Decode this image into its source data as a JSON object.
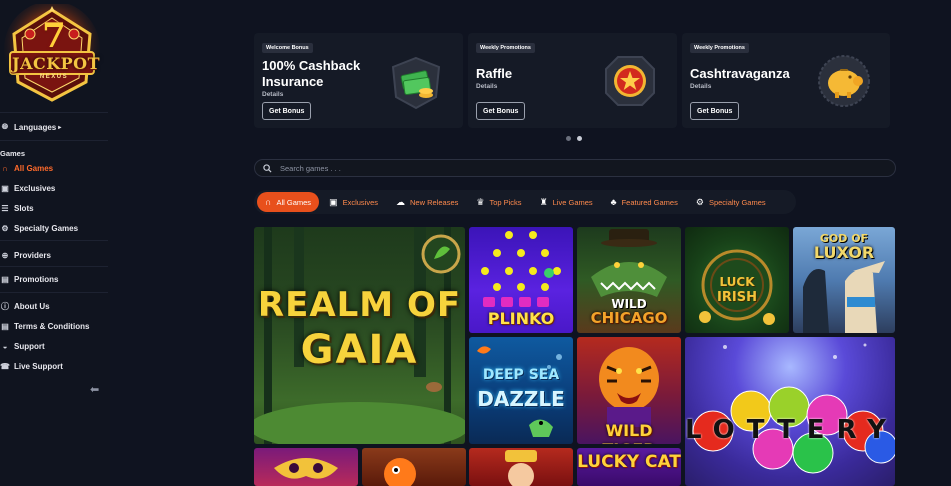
{
  "brand": {
    "logo_text": "JACKPOT",
    "logo_sub": "NEXUS",
    "logo_seven": "7"
  },
  "sidebar": {
    "languages": "Languages",
    "games_section": "Games",
    "items": [
      {
        "label": "All Games",
        "icon": "horseshoe-icon"
      },
      {
        "label": "Exclusives",
        "icon": "exclusive-icon"
      },
      {
        "label": "Slots",
        "icon": "slots-icon"
      },
      {
        "label": "Specialty Games",
        "icon": "gear-icon"
      }
    ],
    "providers": "Providers",
    "promotions": "Promotions",
    "about": "About Us",
    "terms": "Terms & Conditions",
    "support": "Support",
    "live_support": "Live Support"
  },
  "promos": [
    {
      "badge": "Welcome Bonus",
      "title_line1": "100% Cashback",
      "title_line2": "Insurance",
      "details": "Details",
      "button": "Get Bonus",
      "icon": "money-stack-icon"
    },
    {
      "badge": "Weekly Promotions",
      "title_line1": "Raffle",
      "details": "Details",
      "button": "Get Bonus",
      "icon": "star-medal-icon"
    },
    {
      "badge": "Weekly Promotions",
      "title_line1": "Cashtravaganza",
      "details": "Details",
      "button": "Get Bonus",
      "icon": "piggy-bank-icon"
    }
  ],
  "search": {
    "placeholder": "Search games . . ."
  },
  "tabs": [
    {
      "label": "All Games",
      "icon": "horseshoe-icon"
    },
    {
      "label": "Exclusives",
      "icon": "exclusive-icon"
    },
    {
      "label": "New Releases",
      "icon": "new-icon"
    },
    {
      "label": "Top Picks",
      "icon": "trophy-icon"
    },
    {
      "label": "Live Games",
      "icon": "live-icon"
    },
    {
      "label": "Featured Games",
      "icon": "clover-icon"
    },
    {
      "label": "Specialty Games",
      "icon": "gear-icon"
    }
  ],
  "games": {
    "realm_line1": "REALM OF",
    "realm_line2": "GAIA",
    "plinko": "PLINKO",
    "wild_chicago_1": "WILD",
    "wild_chicago_2": "CHICAGO",
    "luck_irish_1": "LUCK",
    "luck_irish_2": "IRISH",
    "god_luxor_1": "GOD OF",
    "god_luxor_2": "LUXOR",
    "deep_sea_1": "DEEP SEA",
    "deep_sea_2": "DAZZLE",
    "wild_tiger": "WILD TIGER",
    "lottery": "LOTTERY",
    "lucky_cat": "LUCKY CAT"
  }
}
